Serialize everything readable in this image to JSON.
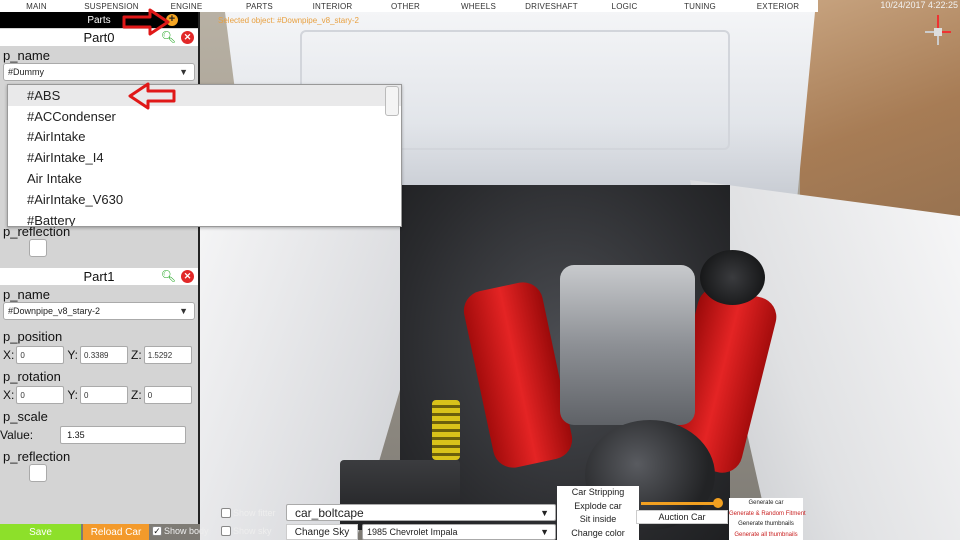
{
  "top_menu": {
    "items": [
      "MAIN",
      "SUSPENSION",
      "ENGINE",
      "PARTS",
      "INTERIOR",
      "OTHER",
      "WHEELS",
      "DRIVESHAFT",
      "LOGIC",
      "TUNING",
      "EXTERIOR"
    ]
  },
  "datetime": "10/24/2017 4:22:25",
  "selected_object": "Selected object: #Downpipe_v8_stary-2",
  "parts_panel": {
    "title": "Parts",
    "add_icon": "plus-circle-icon"
  },
  "part0": {
    "title": "Part0",
    "p_name_label": "p_name",
    "p_name_value": "#Dummy",
    "p_reflection_label": "p_reflection"
  },
  "dropdown": {
    "options": [
      "#ABS",
      "#ACCondenser",
      "#AirIntake",
      "#AirIntake_I4",
      "Air Intake",
      "#AirIntake_V630",
      "#Battery"
    ]
  },
  "part1": {
    "title": "Part1",
    "p_name_label": "p_name",
    "p_name_value": "#Downpipe_v8_stary-2",
    "p_position_label": "p_position",
    "position": {
      "x": "0",
      "y": "0.3389",
      "z": "1.5292"
    },
    "p_rotation_label": "p_rotation",
    "rotation": {
      "x": "0",
      "y": "0",
      "z": "0"
    },
    "p_scale_label": "p_scale",
    "value_label": "Value:",
    "scale_value": "1.35",
    "p_reflection_label": "p_reflection"
  },
  "axis_labels": {
    "x": "X:",
    "y": "Y:",
    "z": "Z:"
  },
  "bottom_bar": {
    "save": "Save",
    "reload": "Reload Car",
    "show_body": "Show body",
    "show_fitter": "Show fitter",
    "show_sky": "Show sky",
    "car_select": "car_boltcape",
    "change_sky": "Change Sky",
    "model_select": "1985 Chevrolet Impala",
    "actions": [
      "Car Stripping",
      "Explode car",
      "Sit inside",
      "Change color"
    ],
    "auction_car": "Auction Car",
    "generate": [
      "Generate car",
      "Generate & Random Fitment",
      "Generate thumbnails",
      "Generate all thumbnails"
    ],
    "slider_value_fraction": 0.96
  },
  "colors": {
    "save": "#8de02a",
    "reload": "#f39a2b",
    "accent_orange": "#f5a623",
    "remove_red": "#e12828",
    "find_green": "#1ca31c",
    "arrow_red": "#e01818"
  }
}
